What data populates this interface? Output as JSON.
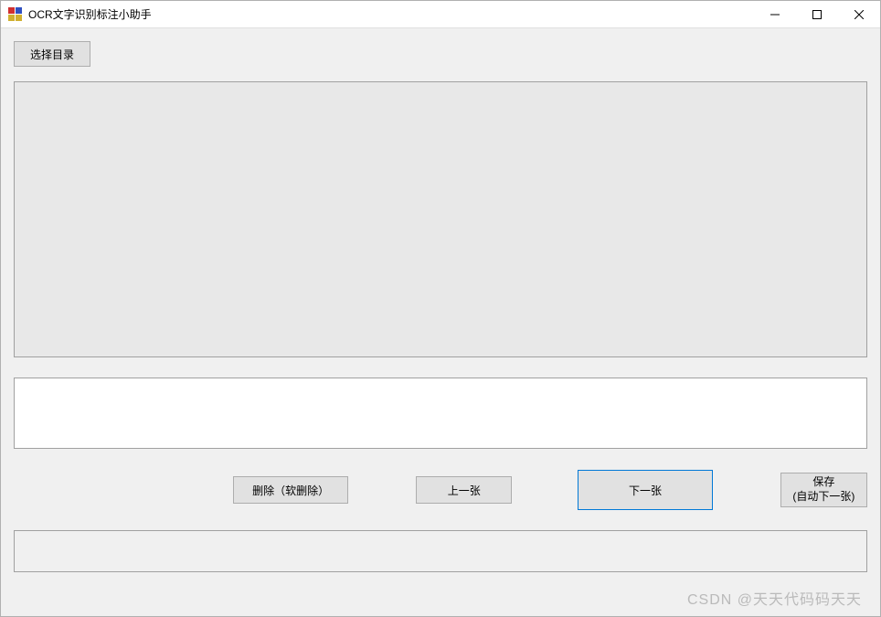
{
  "window": {
    "title": "OCR文字识别标注小助手"
  },
  "toolbar": {
    "select_dir_label": "选择目录"
  },
  "buttons": {
    "delete_label": "删除（软删除）",
    "prev_label": "上一张",
    "next_label": "下一张",
    "save_label": "保存\n(自动下一张)"
  },
  "text_input": {
    "value": ""
  },
  "watermark": "CSDN @天天代码码天天"
}
